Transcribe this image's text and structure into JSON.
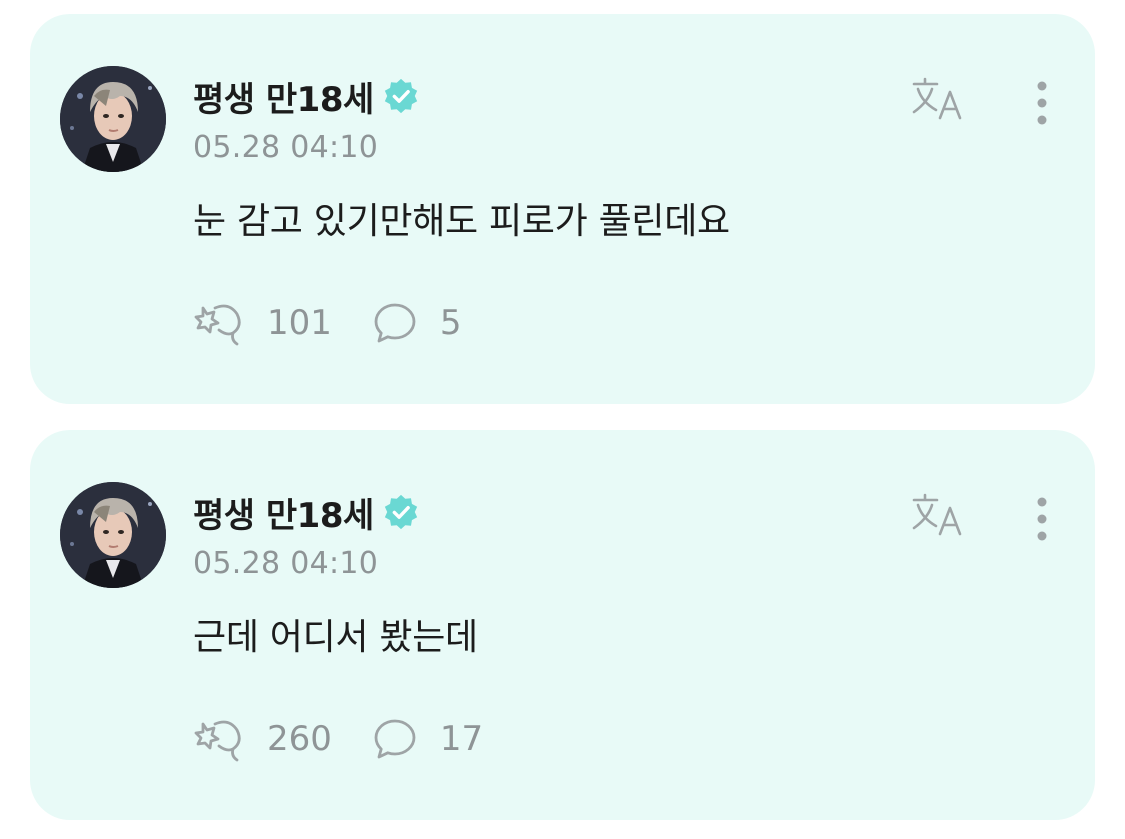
{
  "colors": {
    "card_bg": "#e8faf7",
    "verified_badge": "#6ad8d3",
    "secondary_text": "#8e9496",
    "primary_text": "#1c1c1c"
  },
  "posts": [
    {
      "author": "평생 만18세",
      "verified_icon": "verified-badge-icon",
      "time": "05.28 04:10",
      "body": "눈 감고 있기만해도 피로가 풀린데요",
      "likes": "101",
      "comments": "5",
      "translate_icon": "translate-icon",
      "more_icon": "more-vertical-icon",
      "like_icon": "heart-hands-icon",
      "comment_icon": "speech-bubble-icon"
    },
    {
      "author": "평생 만18세",
      "verified_icon": "verified-badge-icon",
      "time": "05.28 04:10",
      "body": "근데 어디서 봤는데",
      "likes": "260",
      "comments": "17",
      "translate_icon": "translate-icon",
      "more_icon": "more-vertical-icon",
      "like_icon": "heart-hands-icon",
      "comment_icon": "speech-bubble-icon"
    }
  ]
}
